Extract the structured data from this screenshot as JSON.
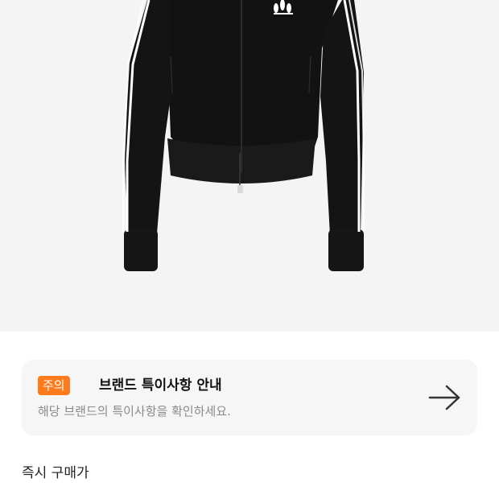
{
  "product": {
    "image_icon": "product-photo-black-track-jacket",
    "logo_text": "adidas"
  },
  "notice": {
    "badge": "주의",
    "title": "브랜드 특이사항 안내",
    "description": "해당 브랜드의 특이사항을 확인하세요.",
    "arrow_icon": "arrow-right-icon",
    "badge_color": "#ff7a1a"
  },
  "price": {
    "label": "즉시 구매가"
  }
}
